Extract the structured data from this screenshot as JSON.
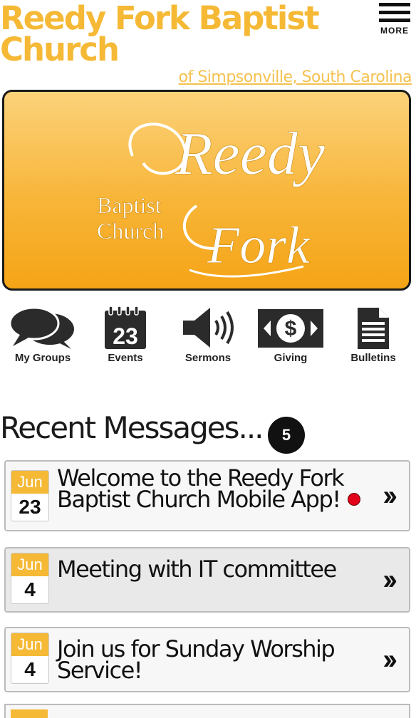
{
  "header": {
    "title": "Reedy Fork Baptist Church",
    "subtitle": "of Simpsonville, South Carolina",
    "more_label": "MORE"
  },
  "banner": {
    "logo_lines": [
      "Reedy",
      "Baptist",
      "Church",
      "Fork"
    ]
  },
  "nav": {
    "items": [
      {
        "label": "My Groups",
        "icon": "chat-bubbles-icon"
      },
      {
        "label": "Events",
        "icon": "calendar-icon",
        "date": "23"
      },
      {
        "label": "Sermons",
        "icon": "speaker-icon"
      },
      {
        "label": "Giving",
        "icon": "dollar-bill-icon"
      },
      {
        "label": "Bulletins",
        "icon": "document-icon"
      }
    ]
  },
  "messages": {
    "title": "Recent Messages...",
    "count": "5",
    "items": [
      {
        "month": "Jun",
        "day": "23",
        "text": "Welcome to the Reedy Fork Baptist Church Mobile App!",
        "unread": true
      },
      {
        "month": "Jun",
        "day": "4",
        "text": "Meeting with IT committee",
        "unread": false
      },
      {
        "month": "Jun",
        "day": "4",
        "text": "Join us for Sunday Worship Service!",
        "unread": false
      }
    ]
  },
  "colors": {
    "brand": "#f5b936",
    "unread": "#e3001b"
  }
}
